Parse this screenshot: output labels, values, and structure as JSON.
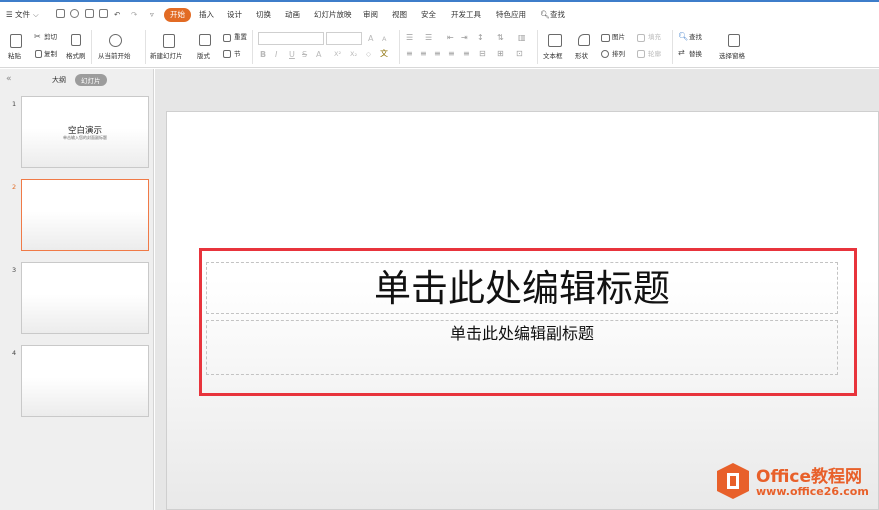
{
  "menubar": {
    "file": "文件",
    "tabs": [
      "开始",
      "插入",
      "设计",
      "切换",
      "动画",
      "幻灯片放映",
      "审阅",
      "视图",
      "安全",
      "开发工具",
      "特色应用"
    ],
    "active_tab": "开始",
    "search": "查找",
    "accent_color": "#e26b24"
  },
  "ribbon": {
    "paste": "粘贴",
    "cut": "剪切",
    "copy": "复制",
    "format_painter": "格式刷",
    "from_current": "从当前开始",
    "new_slide": "新建幻灯片",
    "layout": "版式",
    "reset": "重置",
    "section": "节",
    "font_size_up": "A",
    "font_size_down": "A",
    "bold": "B",
    "italic": "I",
    "underline": "U",
    "strike": "S",
    "font_color": "A",
    "superscript": "X²",
    "subscript": "X₂",
    "clear": "◇",
    "phonetic": "文",
    "textbox": "文本框",
    "shape": "形状",
    "picture": "图片",
    "fill": "填充",
    "arrange": "排列",
    "outline": "轮廓",
    "find": "查找",
    "replace": "替换",
    "select_pane": "选择窗格"
  },
  "leftpane": {
    "tab_outline": "大纲",
    "tab_slides": "幻灯片",
    "thumbnails": [
      {
        "num": "1",
        "title": "空白演示",
        "sub": "单击输入您的封面副标题"
      },
      {
        "num": "2",
        "title": "",
        "sub": ""
      },
      {
        "num": "3",
        "title": "",
        "sub": ""
      },
      {
        "num": "4",
        "title": "",
        "sub": ""
      }
    ],
    "selected_index": 2
  },
  "slide": {
    "title": "单击此处编辑标题",
    "subtitle": "单击此处编辑副标题",
    "highlight_color": "#e8343c"
  },
  "watermark": {
    "brand": "Office教程网",
    "url": "www.office26.com"
  }
}
